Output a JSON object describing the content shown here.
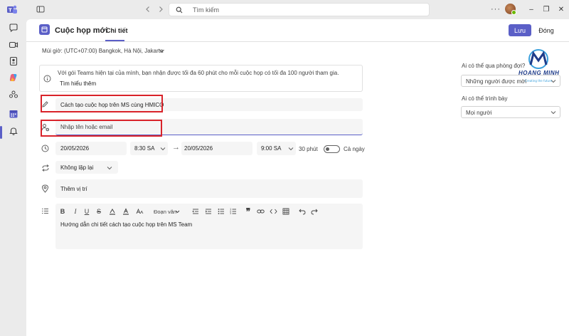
{
  "window": {
    "search_placeholder": "Tìm kiếm",
    "more_glyph": "···",
    "minimize_glyph": "–",
    "maximize_glyph": "❐",
    "close_glyph": "✕"
  },
  "rail": {
    "items": [
      {
        "icon": "activity-icon"
      },
      {
        "icon": "chat-icon"
      },
      {
        "icon": "meet-icon"
      },
      {
        "icon": "copilot-icon"
      },
      {
        "icon": "communities-icon"
      },
      {
        "icon": "calendar-icon"
      },
      {
        "icon": "bell-icon"
      }
    ]
  },
  "header": {
    "title": "Cuộc họp mới",
    "tab_detail": "Chi tiết",
    "save_label": "Lưu",
    "close_label": "Đóng"
  },
  "timezone": "Múi giờ: (UTC+07:00) Bangkok, Hà Nội, Jakarta",
  "info": {
    "text": "Với gói Teams hiện tại của mình, bạn nhận được tối đa 60 phút cho mỗi cuộc họp có tối đa 100 người tham gia.",
    "link": "Tìm hiểu thêm"
  },
  "form": {
    "title_value": "Cách tạo cuộc họp trên MS cùng HMICO",
    "attendee_placeholder": "Nhập tên hoặc email",
    "start_date": "20/05/2026",
    "start_time": "8:30 SA",
    "end_date": "20/05/2026",
    "end_time": "9:00 SA",
    "duration": "30 phút",
    "allday_label": "Cả ngày",
    "allday_on": false,
    "repeat_value": "Không lặp lại",
    "location_placeholder": "Thêm vị trí",
    "editor_text": "Hướng dẫn chi tiết cách tạo cuộc họp trên MS Team"
  },
  "toolbar": {
    "bold": "B",
    "italic": "I",
    "underline": "U",
    "strike": "S",
    "paragraph": "Đoạn văn"
  },
  "right_panel": {
    "bypass_label": "Ai có thể qua phòng đợi?",
    "bypass_value": "Những người được mời",
    "presenter_label": "Ai có thể trình bày",
    "presenter_value": "Mọi người"
  },
  "watermark": {
    "text": "HOANG MINH",
    "tagline": "Creating the future"
  },
  "colors": {
    "accent": "#5b5fc7",
    "highlight_border": "#d9232a",
    "field_bg": "#f5f5f5"
  }
}
